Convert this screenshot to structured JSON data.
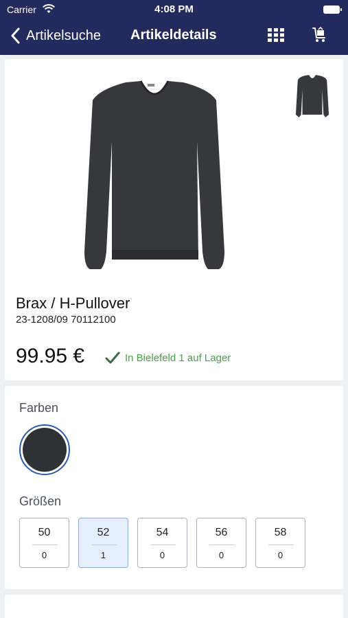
{
  "status_bar": {
    "carrier": "Carrier",
    "time": "4:08 PM"
  },
  "nav": {
    "back_label": "Artikelsuche",
    "title": "Artikeldetails",
    "icons": [
      "grid-icon",
      "cart-icon"
    ]
  },
  "product": {
    "name": "Brax / H-Pullover",
    "sku": "23-1208/09 70112100",
    "price": "99.95 €",
    "stock_status": "In Bielefeld 1 auf Lager"
  },
  "options": {
    "colors_label": "Farben",
    "sizes_label": "Größen",
    "sizes": [
      {
        "size": "50",
        "stock": "0",
        "selected": false
      },
      {
        "size": "52",
        "stock": "1",
        "selected": true
      },
      {
        "size": "54",
        "stock": "0",
        "selected": false
      },
      {
        "size": "56",
        "stock": "0",
        "selected": false
      },
      {
        "size": "58",
        "stock": "0",
        "selected": false
      }
    ]
  },
  "colors": {
    "nav_bg": "#232a5e",
    "stock_green": "#4aa14a",
    "selected_blue": "#2a5db0"
  }
}
